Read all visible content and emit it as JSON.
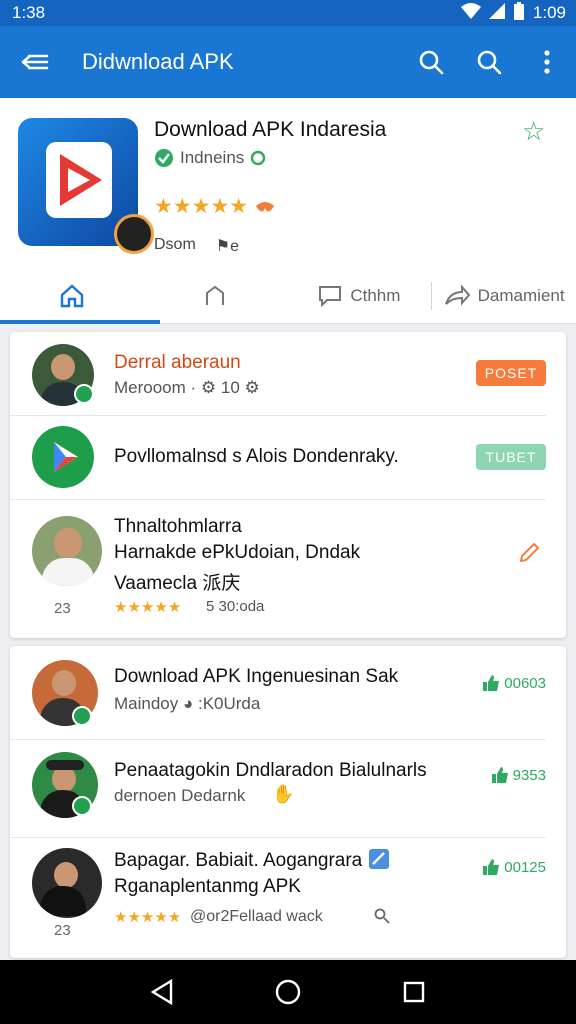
{
  "status": {
    "time_left": "1:38",
    "time_right": "1:09"
  },
  "appbar": {
    "title": "Didwnload APK"
  },
  "app": {
    "title": "Download APK Indaresia",
    "developer": "Indneins",
    "meta_left": "Dsom",
    "meta_right": "⚑e"
  },
  "tabs": [
    {
      "label": ""
    },
    {
      "label": ""
    },
    {
      "label": "Cthhm"
    },
    {
      "label": "Damamient"
    }
  ],
  "list1": [
    {
      "title": "Derral aberaun",
      "sub": "Merooom · ⚙ 10 ⚙",
      "pill": "POSET"
    },
    {
      "title": "Povllomalnsd s Alois Dondenraky.",
      "pill": "TUBET"
    },
    {
      "title1": "Thnaltohmlarra",
      "title2": "Harnakde ePkUdoian, Dndak",
      "title3": "Vaamecla 派庆",
      "num": "23",
      "stars": "★★★★★",
      "sub": "5 30:oda"
    }
  ],
  "list2": [
    {
      "title": "Download APK Ingenuesinan Sak",
      "sub": "Maindoy ◕ :K0Urda",
      "count": "00603"
    },
    {
      "title": "Penaatagokin Dndlaradon Bialulnarls",
      "sub": "dernoen Dedarnk",
      "count": "9353"
    },
    {
      "title1": "Bapagar. Babiait. Aogangrara",
      "title2": "Rganaplentanmg APK",
      "stars": "★★★★★",
      "sub": "@or2Fellaad wack",
      "num": "23",
      "count": "00125"
    }
  ],
  "colors": {
    "primary": "#1976d2",
    "status": "#1565c0",
    "green": "#2eaa62",
    "orange": "#f57c3c",
    "star": "#f5a623"
  }
}
